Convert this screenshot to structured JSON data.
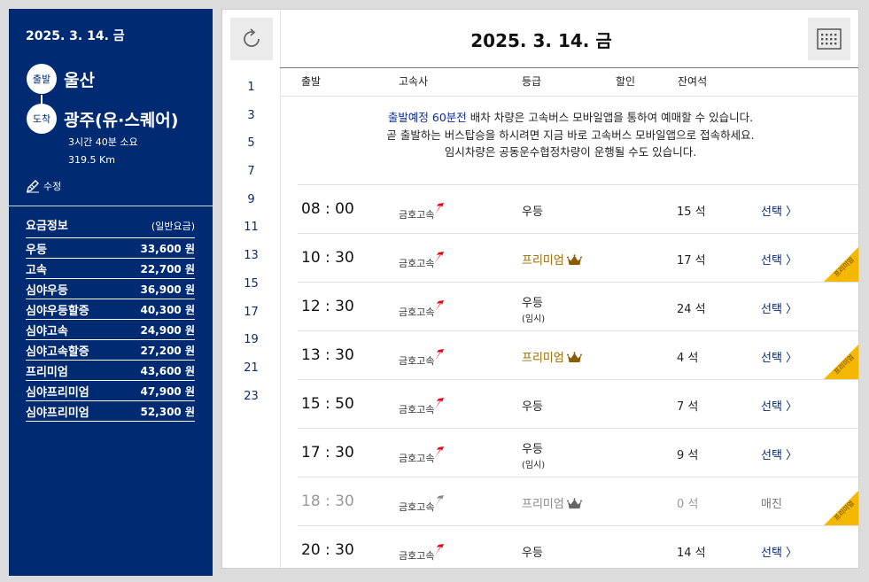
{
  "sidebar": {
    "date": "2025. 3. 14. 금",
    "departure_tag": "출발",
    "departure": "울산",
    "arrival_tag": "도착",
    "arrival": "광주(유·스퀘어)",
    "duration": "3시간 40분 소요",
    "distance": "319.5 Km",
    "edit_label": "수정",
    "fare_title": "요금정보",
    "fare_subtitle": "(일반요금)",
    "fares": [
      {
        "name": "우등",
        "price": "33,600 원"
      },
      {
        "name": "고속",
        "price": "22,700 원"
      },
      {
        "name": "심야우등",
        "price": "36,900 원"
      },
      {
        "name": "심야우등할증",
        "price": "40,300 원"
      },
      {
        "name": "심야고속",
        "price": "24,900 원"
      },
      {
        "name": "심야고속할증",
        "price": "27,200 원"
      },
      {
        "name": "프리미엄",
        "price": "43,600 원"
      },
      {
        "name": "심야프리미엄",
        "price": "47,900 원"
      },
      {
        "name": "심야프리미엄",
        "price": "52,300 원"
      }
    ]
  },
  "main": {
    "date": "2025. 3. 14. 금",
    "hours": [
      "1",
      "3",
      "5",
      "7",
      "9",
      "11",
      "13",
      "15",
      "17",
      "19",
      "21",
      "23"
    ],
    "headers": {
      "depart": "출발",
      "company": "고속사",
      "grade": "등급",
      "discount": "할인",
      "seats": "잔여석"
    },
    "notice": {
      "highlight": "출발예정 60분전",
      "line1": " 배차 차량은 고속버스 모바일앱을 통하여 예매할 수 있습니다.",
      "line2": "곧 출발하는 버스탑승을 하시려면 지금 바로 고속버스 모바일앱으로 접속하세요.",
      "line3": "임시차량은 공동운수협정차량이 운행될 수도 있습니다."
    },
    "badge_text": "프리미엄",
    "schedules": [
      {
        "time": "08 : 00",
        "company": "금호고속",
        "grade": "우등",
        "sub": "",
        "seats": "15 석",
        "action": "선택 〉",
        "premium": false,
        "soldout": false
      },
      {
        "time": "10 : 30",
        "company": "금호고속",
        "grade": "프리미엄",
        "sub": "",
        "seats": "17 석",
        "action": "선택 〉",
        "premium": true,
        "soldout": false
      },
      {
        "time": "12 : 30",
        "company": "금호고속",
        "grade": "우등",
        "sub": "(임시)",
        "seats": "24 석",
        "action": "선택 〉",
        "premium": false,
        "soldout": false
      },
      {
        "time": "13 : 30",
        "company": "금호고속",
        "grade": "프리미엄",
        "sub": "",
        "seats": "4 석",
        "action": "선택 〉",
        "premium": true,
        "soldout": false
      },
      {
        "time": "15 : 50",
        "company": "금호고속",
        "grade": "우등",
        "sub": "",
        "seats": "7 석",
        "action": "선택 〉",
        "premium": false,
        "soldout": false
      },
      {
        "time": "17 : 30",
        "company": "금호고속",
        "grade": "우등",
        "sub": "(임시)",
        "seats": "9 석",
        "action": "선택 〉",
        "premium": false,
        "soldout": false
      },
      {
        "time": "18 : 30",
        "company": "금호고속",
        "grade": "프리미엄",
        "sub": "",
        "seats": "0 석",
        "action": "매진",
        "premium": true,
        "soldout": true
      },
      {
        "time": "20 : 30",
        "company": "금호고속",
        "grade": "우등",
        "sub": "",
        "seats": "14 석",
        "action": "선택 〉",
        "premium": false,
        "soldout": false
      }
    ]
  },
  "colors": {
    "navy": "#002a72",
    "premium": "#9b6a00",
    "badge": "#f5b800",
    "logo_red": "#e60012"
  }
}
